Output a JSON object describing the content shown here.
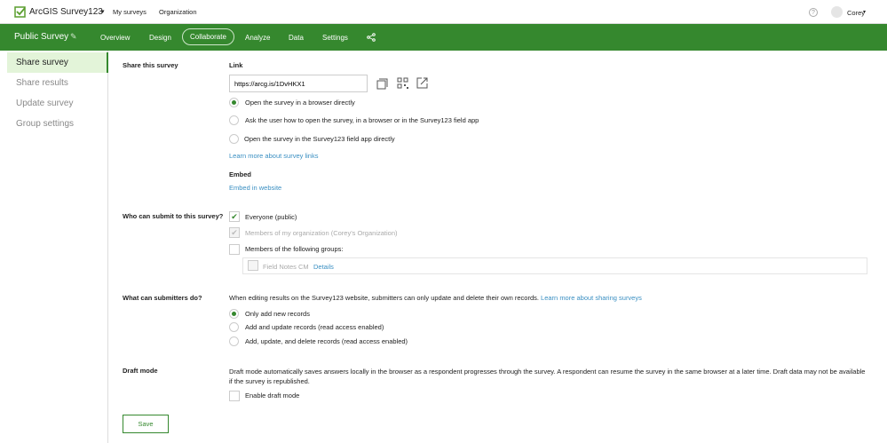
{
  "header": {
    "app_title": "ArcGIS Survey123",
    "nav": [
      "My surveys",
      "Organization"
    ],
    "user": "Corey"
  },
  "survey_bar": {
    "title": "Public Survey",
    "tabs": [
      "Overview",
      "Design",
      "Collaborate",
      "Analyze",
      "Data",
      "Settings"
    ],
    "active_tab": "Collaborate"
  },
  "sidebar": {
    "items": [
      {
        "label": "Share survey",
        "active": true
      },
      {
        "label": "Share results"
      },
      {
        "label": "Update survey"
      },
      {
        "label": "Group settings"
      }
    ]
  },
  "share": {
    "label": "Share this survey",
    "link_heading": "Link",
    "link_value": "https://arcg.is/1DvHKX1",
    "options": [
      "Open the survey in a browser directly",
      "Ask the user how to open the survey, in a browser or in the Survey123 field app",
      "Open the survey in the Survey123 field app directly"
    ],
    "learn_more": "Learn more about survey links",
    "embed_heading": "Embed",
    "embed_link": "Embed in website"
  },
  "who": {
    "label": "Who can submit to this survey?",
    "everyone": "Everyone (public)",
    "org": "Members of my organization (Corey's Organization)",
    "groups": "Members of the following groups:",
    "group_name": "Field Notes CM",
    "details": "Details"
  },
  "what": {
    "label": "What can submitters do?",
    "note": "When editing results on the Survey123 website, submitters can only update and delete their own records.",
    "learn_more": "Learn more about sharing surveys",
    "options": [
      "Only add new records",
      "Add and update records (read access enabled)",
      "Add, update, and delete records (read access enabled)"
    ]
  },
  "draft": {
    "label": "Draft mode",
    "description": "Draft mode automatically saves answers locally in the browser as a respondent progresses through the survey. A respondent can resume the survey in the same browser at a later time. Draft data may not be available if the survey is republished.",
    "checkbox": "Enable draft mode"
  },
  "save_label": "Save"
}
